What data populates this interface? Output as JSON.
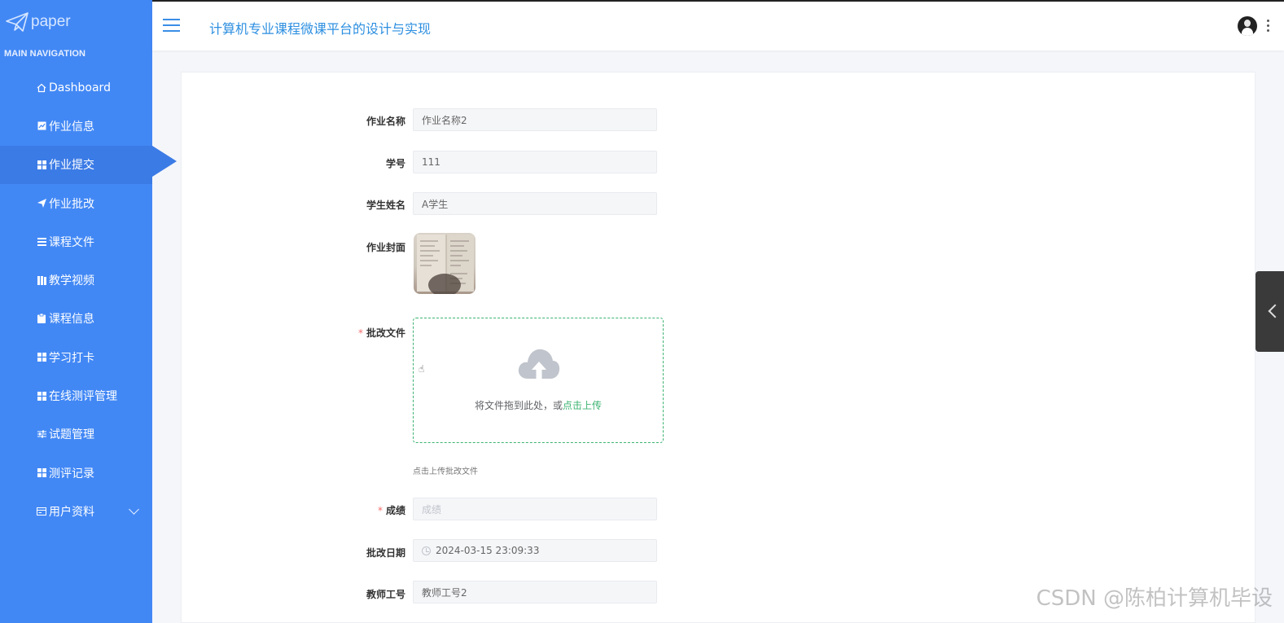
{
  "sidebar": {
    "logo_text": "paper",
    "nav_header": "MAIN NAVIGATION",
    "items": [
      {
        "label": "Dashboard",
        "icon": "home-icon"
      },
      {
        "label": "作业信息",
        "icon": "chart-icon"
      },
      {
        "label": "作业提交",
        "icon": "grid-icon",
        "active": true
      },
      {
        "label": "作业批改",
        "icon": "send-icon"
      },
      {
        "label": "课程文件",
        "icon": "list-icon"
      },
      {
        "label": "教学视频",
        "icon": "book-icon"
      },
      {
        "label": "课程信息",
        "icon": "clipboard-icon"
      },
      {
        "label": "学习打卡",
        "icon": "grid-icon"
      },
      {
        "label": "在线测评管理",
        "icon": "grid-icon"
      },
      {
        "label": "试题管理",
        "icon": "sliders-icon"
      },
      {
        "label": "测评记录",
        "icon": "grid-icon"
      },
      {
        "label": "用户资料",
        "icon": "card-icon",
        "expandable": true
      }
    ]
  },
  "header": {
    "title": "计算机专业课程微课平台的设计与实现"
  },
  "form": {
    "homework_name": {
      "label": "作业名称",
      "value": "作业名称2"
    },
    "student_id": {
      "label": "学号",
      "value": "111"
    },
    "student_name": {
      "label": "学生姓名",
      "value": "A学生"
    },
    "cover": {
      "label": "作业封面"
    },
    "review_file": {
      "label": "批改文件",
      "required": "*",
      "drop_text": "将文件拖到此处，或",
      "click_text": "点击上传",
      "tip": "点击上传批改文件"
    },
    "score": {
      "label": "成绩",
      "required": "*",
      "placeholder": "成绩"
    },
    "review_date": {
      "label": "批改日期",
      "value": "2024-03-15 23:09:33"
    },
    "teacher_id": {
      "label": "教师工号",
      "value": "教师工号2"
    }
  },
  "watermark": "CSDN @陈柏计算机毕设",
  "colors": {
    "sidebar_bg": "#4288f5",
    "sidebar_active": "#3b7be6",
    "title": "#2d8fe0",
    "upload_accent": "#3cb371",
    "required": "#f56c6c"
  }
}
